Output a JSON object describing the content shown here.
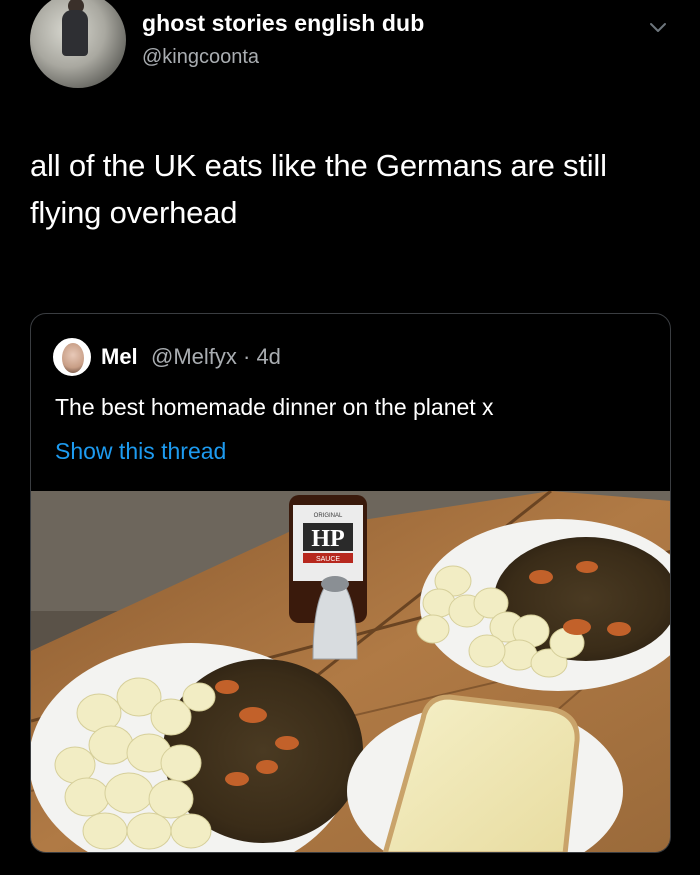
{
  "tweet": {
    "display_name": "ghost stories english dub",
    "handle": "@kingcoonta",
    "text": "all of the UK eats like the Germans are still flying overhead"
  },
  "quoted": {
    "name": "Mel",
    "handle_time": "@Melfyx · 4d",
    "text": "The best homemade dinner on the planet x",
    "thread_link": "Show this thread",
    "photo": {
      "sauce_bottle_brand": "HP",
      "sauce_bottle_label": "SAUCE",
      "sauce_bottle_top": "ORIGINAL"
    }
  },
  "colors": {
    "background": "#000000",
    "secondary_text": "#a9adb1",
    "link": "#1d9bf0",
    "border": "#3a3d41"
  }
}
